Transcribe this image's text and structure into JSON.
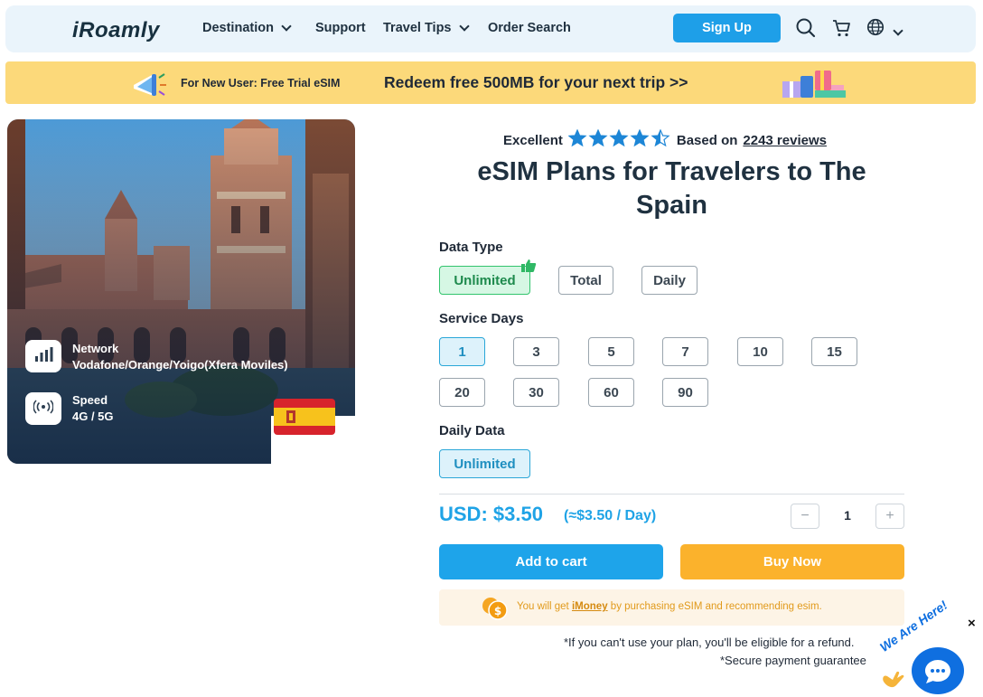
{
  "header": {
    "logo": "iRoamly",
    "nav": [
      {
        "label": "Destination",
        "has_dropdown": true
      },
      {
        "label": "Support",
        "has_dropdown": false
      },
      {
        "label": "Travel Tips",
        "has_dropdown": true
      },
      {
        "label": "Order Search",
        "has_dropdown": false
      }
    ],
    "signup_label": "Sign Up",
    "icons": [
      "search-icon",
      "cart-icon",
      "globe-icon",
      "chevron-down-icon"
    ]
  },
  "promo": {
    "small": "For New User: Free Trial eSIM",
    "big": "Redeem free 500MB for your next trip >>"
  },
  "hero": {
    "network_label": "Network",
    "network_value": "Vodafone/Orange/Yoigo(Xfera Moviles)",
    "speed_label": "Speed",
    "speed_value": "4G / 5G",
    "flag": "spain-flag"
  },
  "rating": {
    "label": "Excellent",
    "stars": 4.5,
    "based_on": "Based on",
    "reviews": "2243 reviews"
  },
  "title": "eSIM Plans for Travelers to The Spain",
  "data_type": {
    "label": "Data Type",
    "options": [
      "Unlimited",
      "Total",
      "Daily"
    ],
    "selected": "Unlimited"
  },
  "service_days": {
    "label": "Service Days",
    "options": [
      "1",
      "3",
      "5",
      "7",
      "10",
      "15",
      "20",
      "30",
      "60",
      "90"
    ],
    "selected": "1"
  },
  "daily_data": {
    "label": "Daily Data",
    "options": [
      "Unlimited"
    ],
    "selected": "Unlimited"
  },
  "price": {
    "amount": "USD: $3.50",
    "per_day": "(≈$3.50 / Day)"
  },
  "quantity": {
    "minus": "−",
    "value": "1",
    "plus": "+"
  },
  "actions": {
    "add_to_cart": "Add to cart",
    "buy_now": "Buy Now"
  },
  "imoney": {
    "prefix": "You will get",
    "link": "iMoney",
    "suffix": "by purchasing eSIM and recommending esim."
  },
  "notes": {
    "refund": "*If you can't use your plan, you'll be eligible for a refund.",
    "secure": "*Secure payment guarantee"
  },
  "chat": {
    "tagline": "We Are Here!",
    "close": "×"
  },
  "colors": {
    "primary": "#1ea4ea",
    "accent": "#fbb22c",
    "promo_bg": "#fcd97a",
    "selected_green": "#32c46d"
  }
}
